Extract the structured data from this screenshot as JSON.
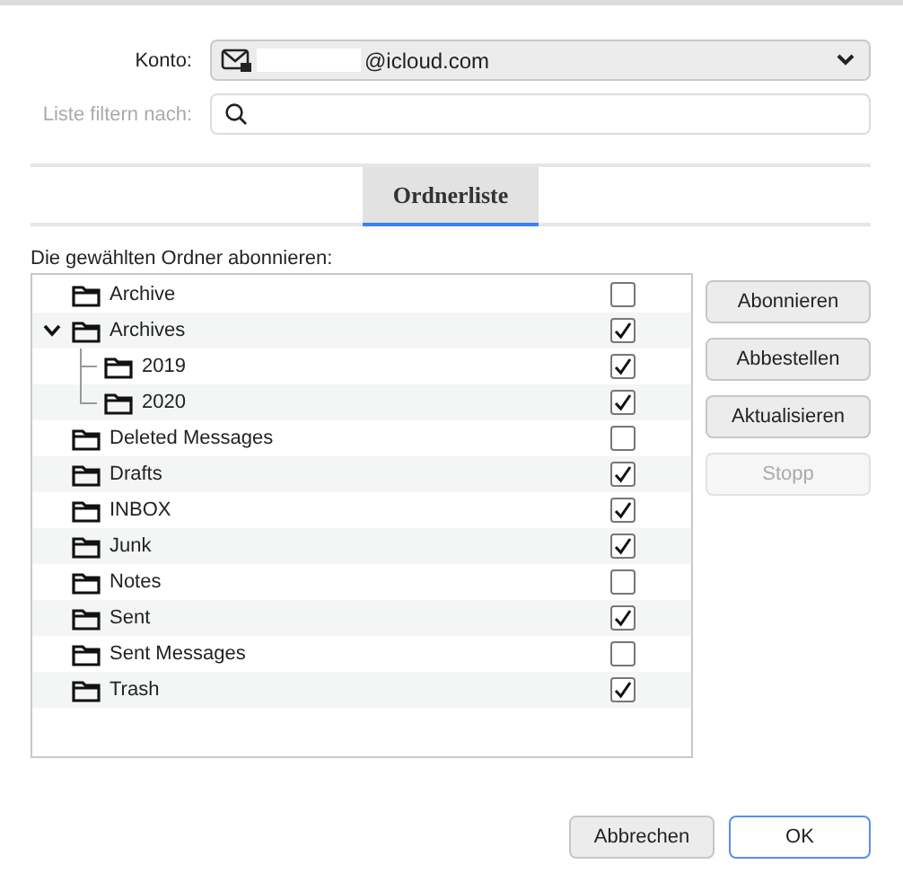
{
  "account": {
    "label": "Konto:",
    "value": "@icloud.com"
  },
  "filter": {
    "label": "Liste filtern nach:",
    "disabled": true
  },
  "tabs": [
    {
      "label": "Ordnerliste",
      "selected": true
    }
  ],
  "folder_list": {
    "heading": "Die gewählten Ordner abonnieren:",
    "folders": [
      {
        "name": "Archive",
        "checked": false
      },
      {
        "name": "Archives",
        "checked": true,
        "expanded": true,
        "children": [
          {
            "name": "2019",
            "checked": true
          },
          {
            "name": "2020",
            "checked": true
          }
        ]
      },
      {
        "name": "Deleted Messages",
        "checked": false
      },
      {
        "name": "Drafts",
        "checked": true
      },
      {
        "name": "INBOX",
        "checked": true
      },
      {
        "name": "Junk",
        "checked": true
      },
      {
        "name": "Notes",
        "checked": false
      },
      {
        "name": "Sent",
        "checked": true
      },
      {
        "name": "Sent Messages",
        "checked": false
      },
      {
        "name": "Trash",
        "checked": true
      }
    ]
  },
  "side_buttons": [
    {
      "label": "Abonnieren",
      "disabled": false
    },
    {
      "label": "Abbestellen",
      "disabled": false
    },
    {
      "label": "Aktualisieren",
      "disabled": false
    },
    {
      "label": "Stopp",
      "disabled": true
    }
  ],
  "footer_buttons": [
    {
      "label": "Abbrechen",
      "default": false
    },
    {
      "label": "OK",
      "default": true
    }
  ]
}
